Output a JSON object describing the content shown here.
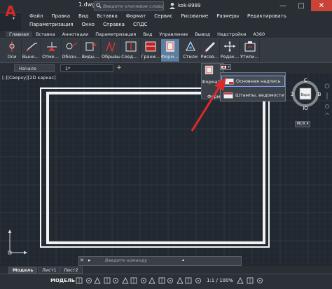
{
  "window": {
    "doc_title": "1.dwg",
    "search_placeholder": "Введите ключевое слово/фразу",
    "user_name": "kok-8989",
    "minimize": "—",
    "maximize": "□",
    "close": "✕"
  },
  "menu": {
    "row1": [
      "Файл",
      "Правка",
      "Вид",
      "Вставка",
      "Формат",
      "Сервис",
      "Рисование",
      "Размеры",
      "Редактировать"
    ],
    "row2": [
      "Параметризация",
      "Окно",
      "Справка",
      "СПДС"
    ]
  },
  "ribbon_tabs": [
    "Главная",
    "Вставка",
    "Аннотации",
    "Параметризация",
    "Вид",
    "Управление",
    "Вывод",
    "Надстройки",
    "A360"
  ],
  "ribbon_active_tab_index": 0,
  "ribbon_buttons": [
    {
      "label": "Оси",
      "icon": "axes-icon"
    },
    {
      "label": "Выноски",
      "icon": "leader-icon"
    },
    {
      "label": "Отметки...",
      "icon": "marks-icon"
    },
    {
      "label": "Обозначе...",
      "icon": "designation-icon"
    },
    {
      "label": "Виды, разр...",
      "icon": "views-icon"
    },
    {
      "label": "Обрывы",
      "icon": "breaks-icon"
    },
    {
      "label": "Соедине...",
      "icon": "joints-icon"
    },
    {
      "label": "Граничн...",
      "icon": "boundary-icon"
    },
    {
      "label": "Форматы",
      "icon": "formats-icon",
      "active": true
    },
    {
      "label": "Стили",
      "icon": "styles-icon"
    },
    {
      "label": "Рисован...",
      "icon": "drawing-icon"
    },
    {
      "label": "Редакти...",
      "icon": "edit-icon"
    },
    {
      "label": "Утилиты",
      "icon": "utilities-icon"
    }
  ],
  "file_tabs": [
    {
      "label": "Начало",
      "active": false
    },
    {
      "label": "1*",
      "active": true
    }
  ],
  "viewport_label": "[-][Сверху][2D каркас]",
  "format_panel": {
    "label_top": "Формат",
    "label_bottom": "Форма"
  },
  "dropdown": {
    "items": [
      {
        "label": "Основная надпись",
        "selected": true
      },
      {
        "label": "Штампы, ведомости",
        "selected": false
      }
    ]
  },
  "viewcube": {
    "north": "С",
    "south": "Ю",
    "west": "З",
    "east": "В",
    "face": "Верх",
    "ucs_label": "МСК"
  },
  "command_line": {
    "placeholder": "Введите команду",
    "close": "✕",
    "prompt": "▸"
  },
  "layout_tabs": [
    {
      "label": "Модель",
      "active": true
    },
    {
      "label": "Лист1",
      "active": false
    },
    {
      "label": "Лист2",
      "active": false
    }
  ],
  "status": {
    "mode": "МОДЕЛЬ",
    "scale": "1:1 / 100%"
  },
  "colors": {
    "accent": "#5b7da0",
    "arrow": "#e02828",
    "logo": "#d42a2a",
    "canvas": "#212830"
  }
}
